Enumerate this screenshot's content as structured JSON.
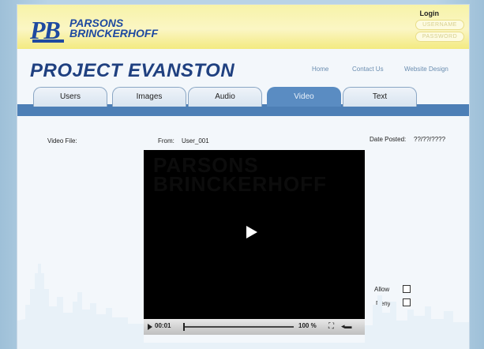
{
  "brand": {
    "logo_initials": "PB",
    "name_line1": "PARSONS",
    "name_line2": "BRINCKERHOFF",
    "colors": {
      "brand_blue": "#1f4aa0",
      "header_yellow": "#f7f3a8",
      "tab_blue": "#4d7fb6"
    }
  },
  "login": {
    "label": "Login",
    "username_placeholder": "USERNAME",
    "password_placeholder": "PASSWORD"
  },
  "project_title": "PROJECT EVANSTON",
  "top_nav": {
    "home": "Home",
    "contact": "Contact Us",
    "website": "Website Design"
  },
  "tabs": [
    {
      "label": "Users",
      "active": false
    },
    {
      "label": "Images",
      "active": false
    },
    {
      "label": "Audio",
      "active": false
    },
    {
      "label": "Video",
      "active": true
    },
    {
      "label": "Text",
      "active": false
    }
  ],
  "video_section": {
    "file_label": "Video File:",
    "from_label": "From:",
    "from_value": "User_001",
    "date_label": "Date Posted:",
    "date_value": "??/??/????",
    "ghost_line1": "PARSONS",
    "ghost_line2": "BRINCKERHOFF"
  },
  "player": {
    "time": "00:01",
    "zoom": "100 %",
    "play_icon": "play-icon",
    "fullscreen_icon": "fullscreen-icon",
    "volume_icon": "volume-icon"
  },
  "moderation": {
    "allow_label": "Allow",
    "deny_label": "Deny"
  }
}
